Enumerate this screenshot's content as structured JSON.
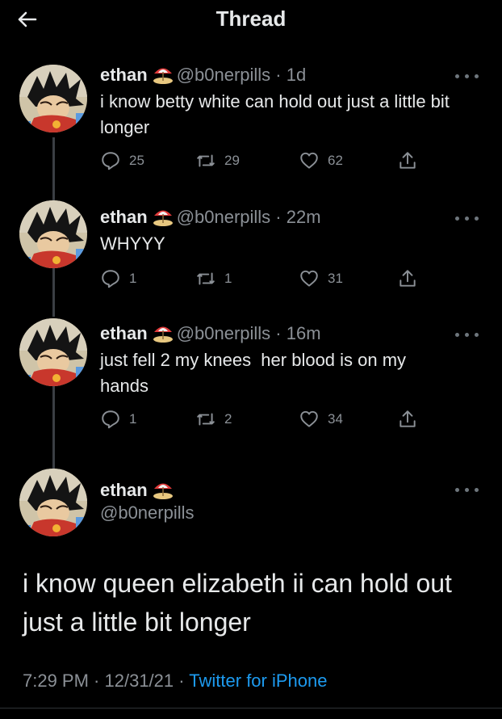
{
  "header": {
    "title": "Thread",
    "back_icon": "arrow-left-icon"
  },
  "user": {
    "name": "ethan",
    "handle": "@b0nerpills",
    "name_emoji": "beach-umbrella-emoji"
  },
  "tweets": [
    {
      "time": "1d",
      "text": "i know betty white can hold out just a little bit longer",
      "replies": "25",
      "retweets": "29",
      "likes": "62"
    },
    {
      "time": "22m",
      "text": "WHYYY",
      "replies": "1",
      "retweets": "1",
      "likes": "31"
    },
    {
      "time": "16m",
      "text": "just fell 2 my knees  her blood is on my hands",
      "replies": "1",
      "retweets": "2",
      "likes": "34"
    }
  ],
  "main_tweet": {
    "text": "i know queen elizabeth ii can hold out just a little bit longer",
    "time": "7:29 PM",
    "date": "12/31/21",
    "source": "Twitter for iPhone"
  },
  "colors": {
    "background": "#000000",
    "text": "#e7e9ea",
    "muted": "#8b9096",
    "accent": "#1d9bf0"
  }
}
